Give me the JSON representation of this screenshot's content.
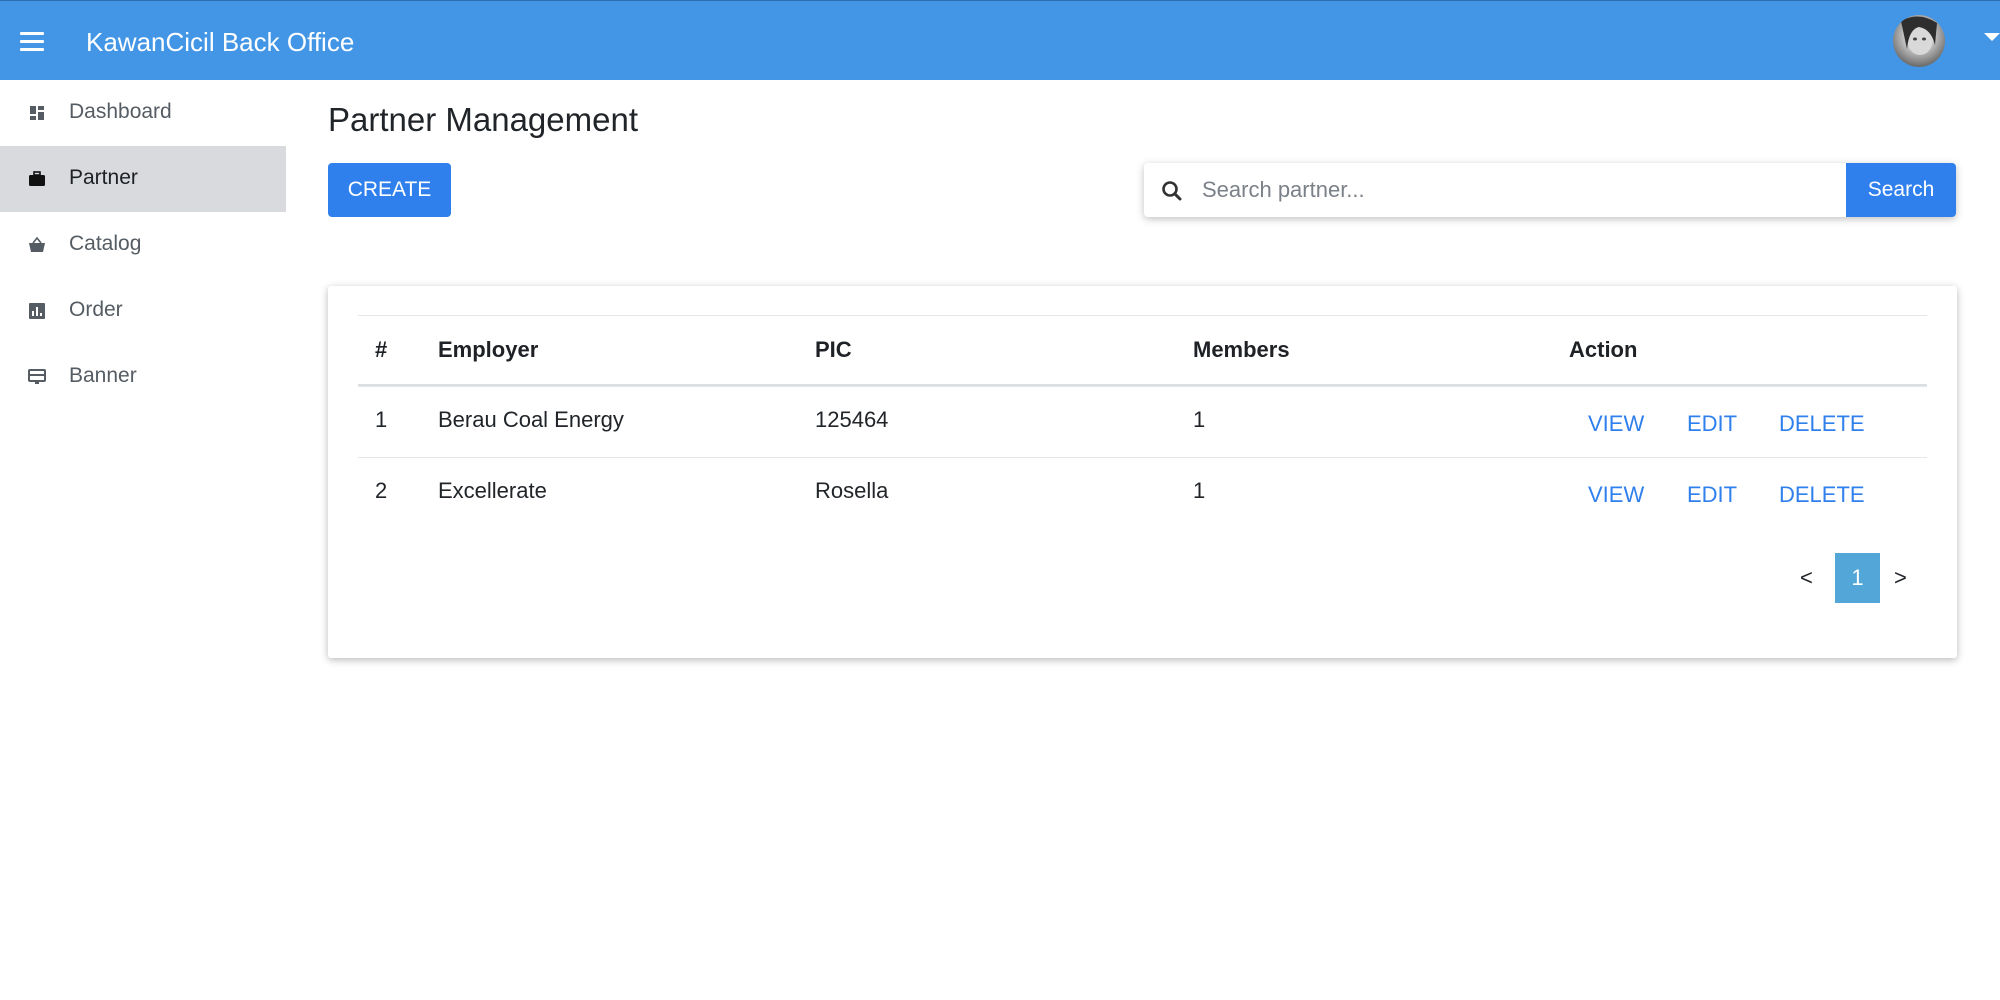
{
  "header": {
    "app_title": "KawanCicil Back Office",
    "brand_color": "#4396e6"
  },
  "sidebar": {
    "items": [
      {
        "label": "Dashboard",
        "icon": "dashboard-icon"
      },
      {
        "label": "Partner",
        "icon": "briefcase-icon",
        "active": true
      },
      {
        "label": "Catalog",
        "icon": "basket-icon"
      },
      {
        "label": "Order",
        "icon": "bar-chart-icon"
      },
      {
        "label": "Banner",
        "icon": "monitor-icon"
      }
    ]
  },
  "main": {
    "title": "Partner Management",
    "create_label": "CREATE",
    "search": {
      "placeholder": "Search partner...",
      "value": "",
      "button_label": "Search"
    },
    "table": {
      "columns": [
        "#",
        "Employer",
        "PIC",
        "Members",
        "Action"
      ],
      "rows": [
        {
          "num": "1",
          "employer": "Berau Coal Energy",
          "pic": "125464",
          "members": "1"
        },
        {
          "num": "2",
          "employer": "Excellerate",
          "pic": "Rosella",
          "members": "1"
        }
      ],
      "actions": {
        "view": "VIEW",
        "edit": "EDIT",
        "delete": "DELETE"
      }
    },
    "pagination": {
      "prev": "<",
      "current_page": "1",
      "next": ">"
    }
  },
  "colors": {
    "primary_button": "#2f80ed",
    "active_page": "#53a7d8",
    "sidebar_active_bg": "#d8dadd"
  }
}
